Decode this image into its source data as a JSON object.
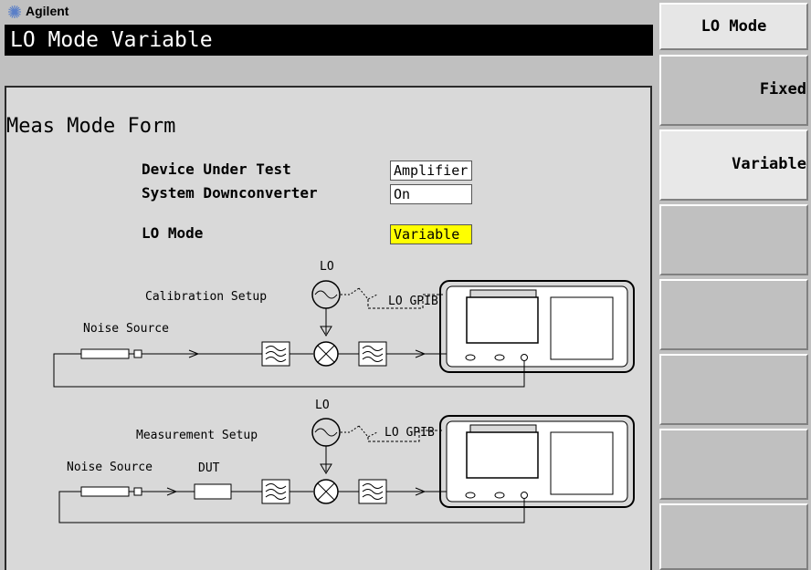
{
  "brand": {
    "name": "Agilent"
  },
  "header": {
    "title": "LO Mode Variable"
  },
  "form": {
    "title": "Meas Mode Form",
    "fields": [
      {
        "label": "Device Under Test",
        "value": "Amplifier"
      },
      {
        "label": "System Downconverter",
        "value": "On"
      },
      {
        "label": "LO Mode",
        "value": "Variable"
      }
    ]
  },
  "diagram": {
    "calibration": {
      "title": "Calibration Setup",
      "lo_label": "LO",
      "gpib_label": "LO GPIB",
      "noise_source_label": "Noise Source"
    },
    "measurement": {
      "title": "Measurement Setup",
      "lo_label": "LO",
      "gpib_label": "LO GPIB",
      "noise_source_label": "Noise Source",
      "dut_label": "DUT"
    }
  },
  "softkeys": {
    "menu_title": "LO Mode",
    "items": [
      {
        "label": "Fixed"
      },
      {
        "label": "Variable"
      },
      {
        "label": ""
      },
      {
        "label": ""
      },
      {
        "label": ""
      },
      {
        "label": ""
      },
      {
        "label": ""
      }
    ]
  },
  "colors": {
    "highlight_field": "#ffff00",
    "title_bar": "#000000",
    "panel": "#c0c0c0"
  }
}
